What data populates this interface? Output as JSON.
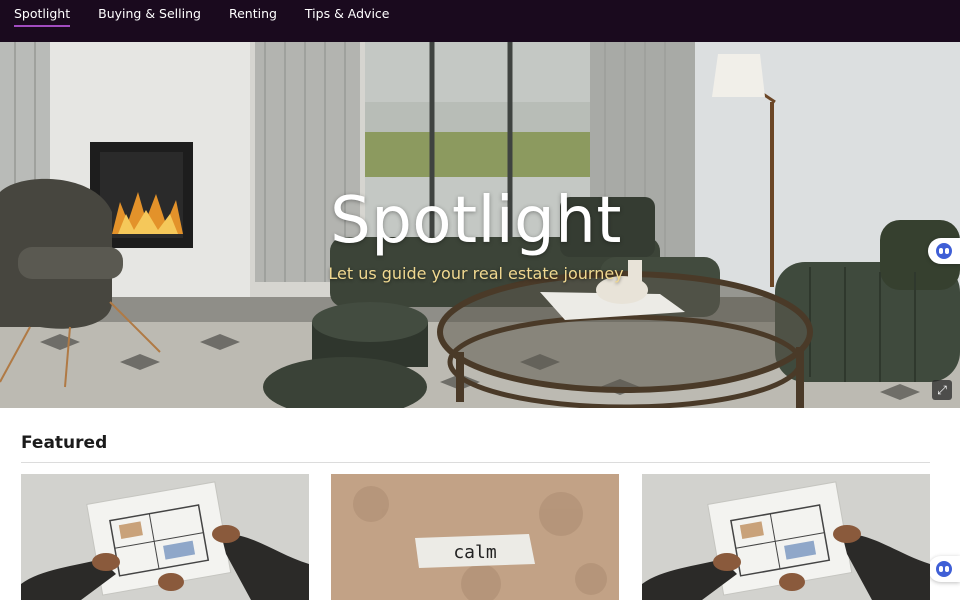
{
  "nav": {
    "items": [
      {
        "label": "Spotlight",
        "active": true
      },
      {
        "label": "Buying & Selling",
        "active": false
      },
      {
        "label": "Renting",
        "active": false
      },
      {
        "label": "Tips & Advice",
        "active": false
      }
    ]
  },
  "hero": {
    "title": "Spotlight",
    "subtitle": "Let us guide your real estate journey",
    "expand_icon": "expand-icon"
  },
  "featured": {
    "heading": "Featured",
    "cards": [
      {
        "image": "floor-plan-hands-image"
      },
      {
        "image": "calm-paper-image",
        "image_text": "calm"
      },
      {
        "image": "floor-plan-hands-image"
      }
    ]
  },
  "assistant": {
    "icon": "assistant-icon"
  },
  "colors": {
    "nav_bg": "#1a0a1e",
    "nav_active_underline": "#a24cc0",
    "subtitle": "#f0d890",
    "assistant": "#3f5fd6"
  }
}
